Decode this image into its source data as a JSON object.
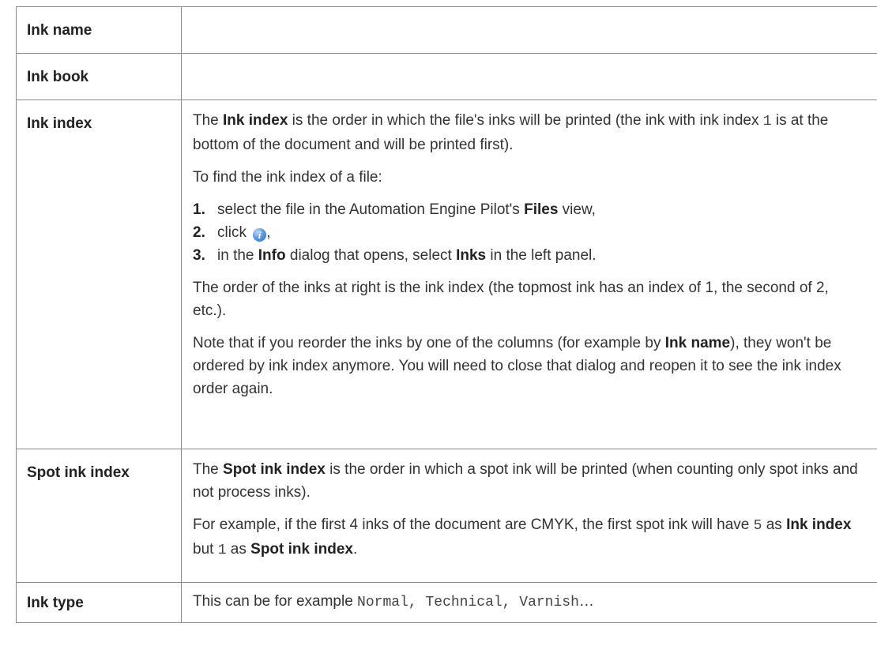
{
  "rows": {
    "ink_name": {
      "term": "Ink name"
    },
    "ink_book": {
      "term": "Ink book"
    },
    "ink_index": {
      "term": "Ink index",
      "p1": {
        "a": "The ",
        "b": "Ink index",
        "c": " is the order in which the file's inks will be printed (the ink with ink index ",
        "code": "1",
        "d": " is at the bottom of the document and will be printed first)."
      },
      "p2": "To find the ink index of a file:",
      "steps": [
        {
          "num": "1.",
          "a": "select the file in the Automation Engine Pilot's ",
          "b": "Files",
          "c": " view,"
        },
        {
          "num": "2.",
          "a": "click ",
          "icon": "info-icon",
          "c": ","
        },
        {
          "num": "3.",
          "a": "in the ",
          "b": "Info",
          "c": " dialog that opens, select ",
          "d": "Inks",
          "e": " in the left panel."
        }
      ],
      "p3": "The order of the inks at right is the ink index (the topmost ink has an index of 1, the second of 2, etc.).",
      "p4": {
        "a": "Note that if you reorder the inks by one of the columns (for example by ",
        "b": "Ink name",
        "c": "), they won't be ordered by ink index anymore. You will need to close that dialog and reopen it to see the ink index order again."
      }
    },
    "spot_ink_index": {
      "term": "Spot ink index",
      "p1": {
        "a": "The ",
        "b": "Spot ink index",
        "c": " is the order in which a spot ink will be printed (when counting only spot inks and not process inks)."
      },
      "p2": {
        "a": "For example, if the first 4 inks of the document are CMYK, the first spot ink will have ",
        "code1": "5",
        "b": " as ",
        "bold1": "Ink index",
        "c": " but ",
        "code2": "1",
        "d": " as ",
        "bold2": "Spot ink index",
        "e": "."
      }
    },
    "ink_type": {
      "term": "Ink type",
      "a": "This can be for example ",
      "code": "Normal, Technical, Varnish",
      "b": "…"
    }
  },
  "colors": {
    "text": "#333333",
    "border": "#8a8a8a",
    "info_icon": "#3d80d6"
  }
}
